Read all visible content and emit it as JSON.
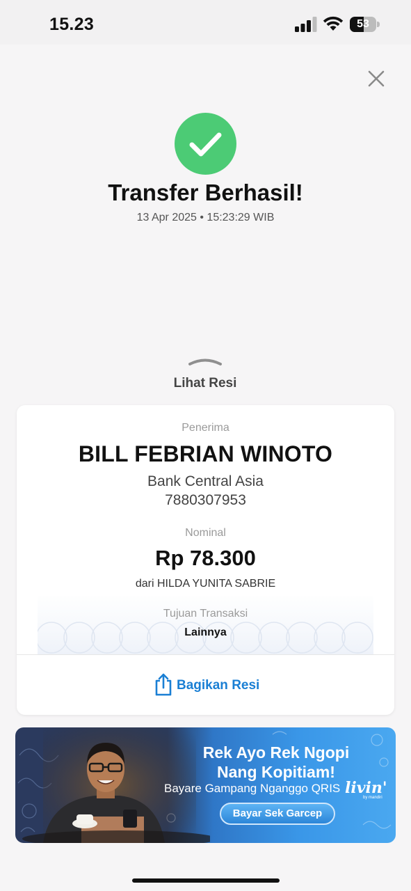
{
  "status_bar": {
    "time": "15.23",
    "battery_level": "53"
  },
  "header": {
    "title": "Transfer Berhasil!",
    "timestamp": "13 Apr 2025 • 15:23:29 WIB",
    "success_color": "#4ccb75"
  },
  "receipt_toggle": {
    "label": "Lihat Resi"
  },
  "receipt": {
    "recipient_label": "Penerima",
    "recipient_name": "BILL FEBRIAN WINOTO",
    "bank_name": "Bank Central Asia",
    "account_number": "7880307953",
    "amount_label": "Nominal",
    "amount": "Rp 78.300",
    "sender": "dari HILDA YUNITA SABRIE",
    "purpose_label": "Tujuan Transaksi",
    "purpose_value": "Lainnya",
    "share_label": "Bagikan Resi",
    "accent_color": "#1a7fd4"
  },
  "banner": {
    "headline_line1": "Rek Ayo Rek Ngopi",
    "headline_line2": "Nang Kopitiam!",
    "subtitle": "Bayare Gampang Nganggo QRIS",
    "brand": "livin'",
    "brand_sub": "by mandiri",
    "cta_label": "Bayar Sek Garcep"
  }
}
